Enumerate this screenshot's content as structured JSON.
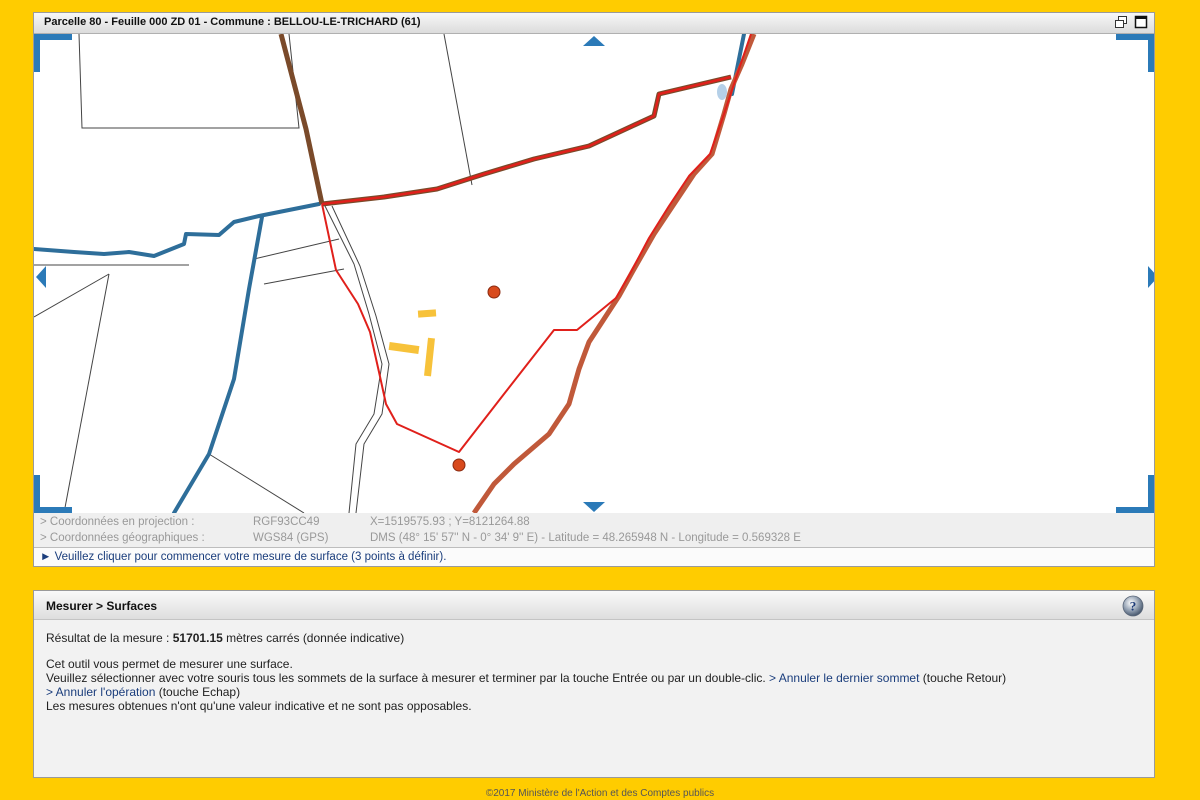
{
  "map": {
    "title": "Parcelle 80 - Feuille 000 ZD 01 - Commune : BELLOU-LE-TRICHARD (61)",
    "controls": {
      "restore_icon": "restore-window-icon",
      "maximize_icon": "maximize-window-icon",
      "pan_icons": [
        "pan-up-icon",
        "pan-down-icon",
        "pan-left-icon",
        "pan-right-icon"
      ]
    },
    "coordinates": {
      "projection": {
        "label": "> Coordonnées en projection :",
        "system": "RGF93CC49",
        "value": "X=1519575.93 ; Y=8121264.88"
      },
      "geographic": {
        "label": "> Coordonnées géographiques :",
        "system": "WGS84 (GPS)",
        "value": "DMS (48° 15' 57'' N - 0° 34' 9'' E) - Latitude = 48.265948 N - Longitude = 0.569328 E"
      }
    },
    "status": "► Veuillez cliquer pour commencer votre mesure de surface (3 points à définir).",
    "colors": {
      "parcel_outline": "#e0201b",
      "commune_limit": "#7a4a2a",
      "waterway": "#2e6e9a",
      "building": "#f7c23a",
      "marker": "#d84a1c",
      "navigation": "#2b7ab8"
    }
  },
  "measure": {
    "title": "Mesurer > Surfaces",
    "help_icon": "help-icon",
    "result_prefix": "Résultat de la mesure : ",
    "result_value": "51701.15",
    "result_suffix": " mètres carrés (donnée indicative)",
    "line1": "Cet outil vous permet de mesurer une surface.",
    "line2_text": "Veuillez sélectionner avec votre souris tous les sommets de la surface à mesurer et terminer par la touche Entrée ou par un double-clic. ",
    "undo_last_link": "> Annuler le dernier sommet",
    "undo_last_key": " (touche Retour)",
    "cancel_link": "> Annuler l'opération",
    "cancel_key": " (touche Echap)",
    "line4": "Les mesures obtenues n'ont qu'une valeur indicative et ne sont pas opposables."
  },
  "footer": {
    "copyright": "©2017 Ministère de l'Action et des Comptes publics"
  }
}
